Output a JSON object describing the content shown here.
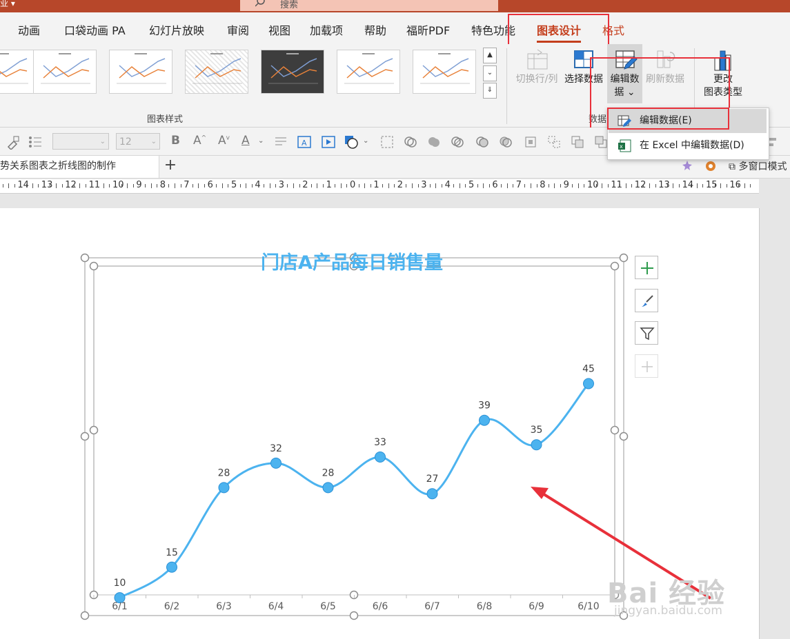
{
  "titlebar": {
    "app_label": "业 ▾",
    "search_placeholder": "搜索"
  },
  "tabs": [
    "动画",
    "口袋动画 PA",
    "幻灯片放映",
    "审阅",
    "视图",
    "加载项",
    "帮助",
    "福昕PDF",
    "特色功能",
    "图表设计",
    "格式"
  ],
  "active_tab": "图表设计",
  "ribbon": {
    "chart_styles_label": "图表样式",
    "switch_row_col": "切换行/列",
    "select_data": "选择数据",
    "edit_data_line1": "编辑数",
    "edit_data_line2": "据",
    "edit_data_chev": "⌄",
    "refresh_data": "刷新数据",
    "data_group_label": "数据",
    "change_type_line1": "更改",
    "change_type_line2": "图表类型"
  },
  "dropdown": {
    "items": [
      {
        "label": "编辑数据(E)",
        "icon": "edit-data-icon"
      },
      {
        "label": "在 Excel 中编辑数据(D)",
        "icon": "excel-icon"
      }
    ]
  },
  "format_bar": {
    "font_name": "",
    "font_size": "12"
  },
  "doc_tabs": {
    "current": "势关系图表之折线图的制作",
    "add": "+",
    "multi_window": "多窗口模式"
  },
  "ruler": {
    "labels": [
      "5",
      "14",
      "13",
      "12",
      "11",
      "10",
      "9",
      "8",
      "7",
      "6",
      "5",
      "4",
      "3",
      "2",
      "1",
      "0",
      "1",
      "2",
      "3",
      "4",
      "5",
      "6",
      "7",
      "8",
      "9",
      "10",
      "11",
      "12",
      "13",
      "14",
      "15",
      "16"
    ]
  },
  "colors": {
    "accent": "#c43e1c",
    "line": "#4cb3ef",
    "highlight": "#e8303a"
  },
  "chart_data": {
    "type": "line",
    "title": "门店A产品每日销售量",
    "categories": [
      "6/1",
      "6/2",
      "6/3",
      "6/4",
      "6/5",
      "6/6",
      "6/7",
      "6/8",
      "6/9",
      "6/10"
    ],
    "values": [
      10,
      15,
      28,
      32,
      28,
      33,
      27,
      39,
      35,
      45
    ],
    "data_labels": true,
    "smooth": true,
    "markers": true,
    "grid": false,
    "legend": "none"
  },
  "watermark": {
    "big": "Bai 经验",
    "small": "jingyan.baidu.com"
  }
}
